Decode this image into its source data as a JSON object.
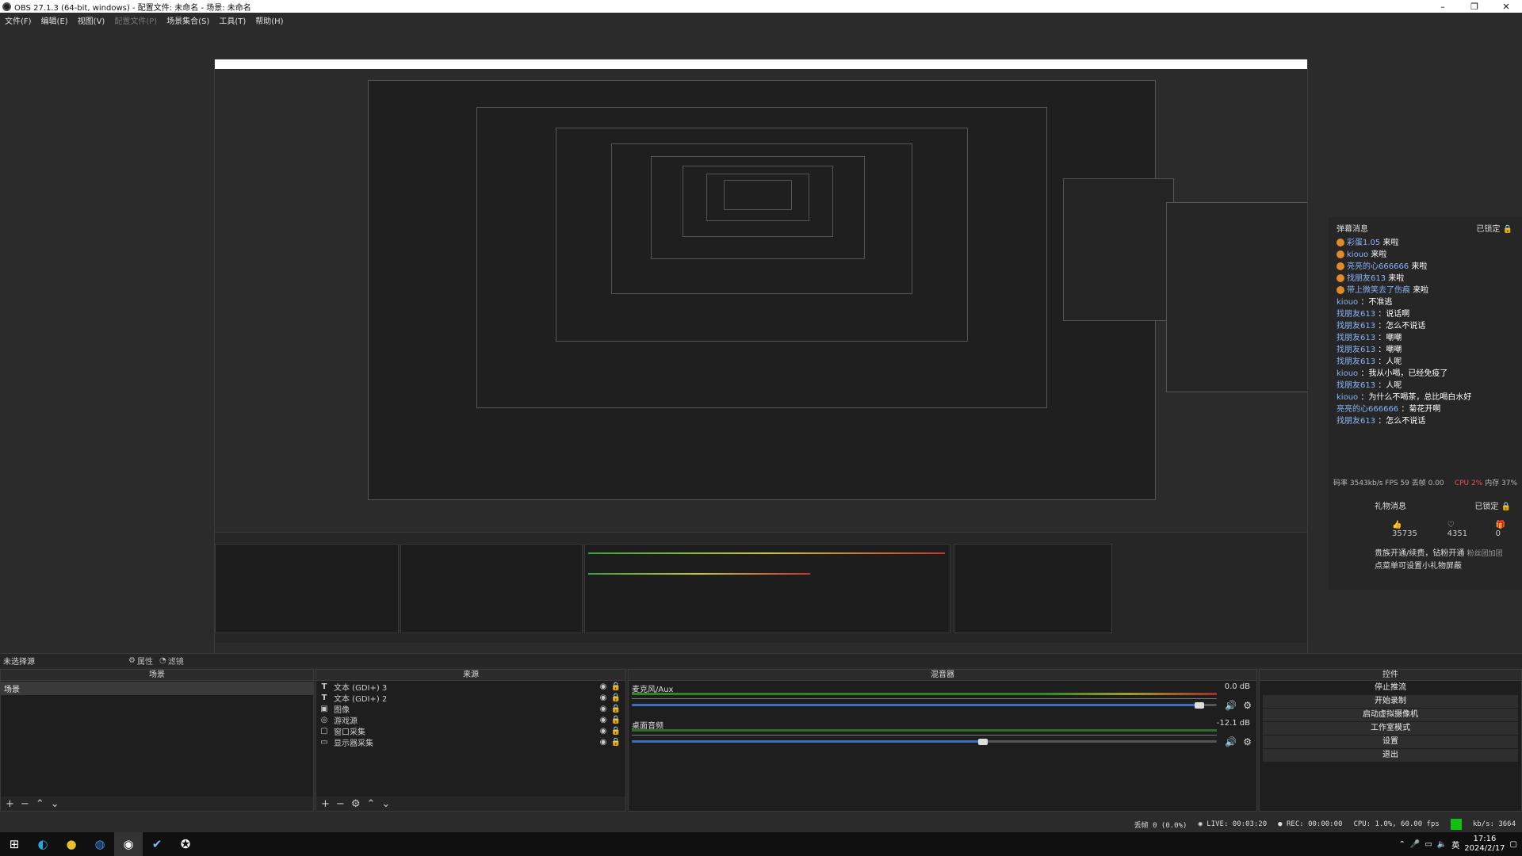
{
  "titlebar": {
    "title": "OBS 27.1.3 (64-bit, windows) - 配置文件: 未命名 - 场景: 未命名"
  },
  "menu": [
    {
      "label": "文件(F)",
      "disabled": false
    },
    {
      "label": "编辑(E)",
      "disabled": false
    },
    {
      "label": "视图(V)",
      "disabled": false
    },
    {
      "label": "配置文件(P)",
      "disabled": true
    },
    {
      "label": "场景集合(S)",
      "disabled": false
    },
    {
      "label": "工具(T)",
      "disabled": false
    },
    {
      "label": "帮助(H)",
      "disabled": false
    }
  ],
  "chat": {
    "title": "弹幕消息",
    "locked": "已锁定",
    "lines": [
      {
        "badge": true,
        "name": "彩蛋1.05",
        "msg": "来啦"
      },
      {
        "badge": true,
        "name": "kiouo",
        "msg": "来啦"
      },
      {
        "badge": true,
        "name": "亮亮的心666666",
        "msg": "来啦"
      },
      {
        "badge": true,
        "name": "找朋友613",
        "msg": "来啦"
      },
      {
        "badge": true,
        "name": "带上微笑去了伤痕",
        "msg": "来啦"
      },
      {
        "badge": false,
        "name": "kiouo",
        "msg": "：不准逃"
      },
      {
        "badge": false,
        "name": "找朋友613",
        "msg": "：说话啊"
      },
      {
        "badge": false,
        "name": "找朋友613",
        "msg": "：怎么不说话"
      },
      {
        "badge": false,
        "name": "找朋友613",
        "msg": "：嘲嘲"
      },
      {
        "badge": false,
        "name": "找朋友613",
        "msg": "：嘲嘲"
      },
      {
        "badge": false,
        "name": "找朋友613",
        "msg": "：人呢"
      },
      {
        "badge": false,
        "name": "kiouo",
        "msg": "：我从小喝，已经免疫了"
      },
      {
        "badge": false,
        "name": "找朋友613",
        "msg": "：人呢"
      },
      {
        "badge": false,
        "name": "kiouo",
        "msg": "：为什么不喝茶，总比喝白水好"
      },
      {
        "badge": false,
        "name": "亮亮的心666666",
        "msg": "：菊花开啊"
      },
      {
        "badge": false,
        "name": "找朋友613",
        "msg": "：怎么不说话"
      }
    ],
    "stats_left": "码率 3543kb/s FPS 59 丢帧 0.00",
    "stats_cpu": "CPU 2%",
    "stats_mem": "内存 37%"
  },
  "gift": {
    "title": "礼物消息",
    "locked": "已锁定",
    "likes": "35735",
    "hearts": "4351",
    "gifts": "0",
    "note_line1": "贵族开通/续费，钻粉开通",
    "note_line2": "点菜单可设置小礼物屏蔽",
    "note_side": "粉丝团加团"
  },
  "dock": {
    "no_scene": "未选择源",
    "tab_properties": "属性",
    "tab_filters": "滤镜",
    "scenes_header": "场景",
    "scene_item": "场景",
    "sources_header": "来源",
    "sources": [
      {
        "icon": "T",
        "name": "文本 (GDI+) 3"
      },
      {
        "icon": "T",
        "name": "文本 (GDI+) 2"
      },
      {
        "icon": "▣",
        "name": "图像"
      },
      {
        "icon": "◎",
        "name": "游戏源"
      },
      {
        "icon": "▢",
        "name": "窗口采集"
      },
      {
        "icon": "▭",
        "name": "显示器采集"
      }
    ],
    "mixer_header": "混音器",
    "channels": [
      {
        "name": "麦克风/Aux",
        "db": "0.0 dB",
        "level": 0.97
      },
      {
        "name": "桌面音频",
        "db": "-12.1 dB",
        "level": 0.6
      }
    ],
    "controls_header": "控件",
    "controls": [
      "停止推流",
      "开始录制",
      "启动虚拟摄像机",
      "工作室模式",
      "设置",
      "退出"
    ]
  },
  "status": {
    "dropped": "丢帧 0 (0.0%)",
    "live": "LIVE: 00:03:20",
    "rec": "REC: 00:00:00",
    "cpu": "CPU: 1.0%, 60.00 fps",
    "kbps": "kb/s: 3664"
  },
  "taskbar": {
    "time": "17:16",
    "date": "2024/2/17",
    "ime": "英"
  }
}
